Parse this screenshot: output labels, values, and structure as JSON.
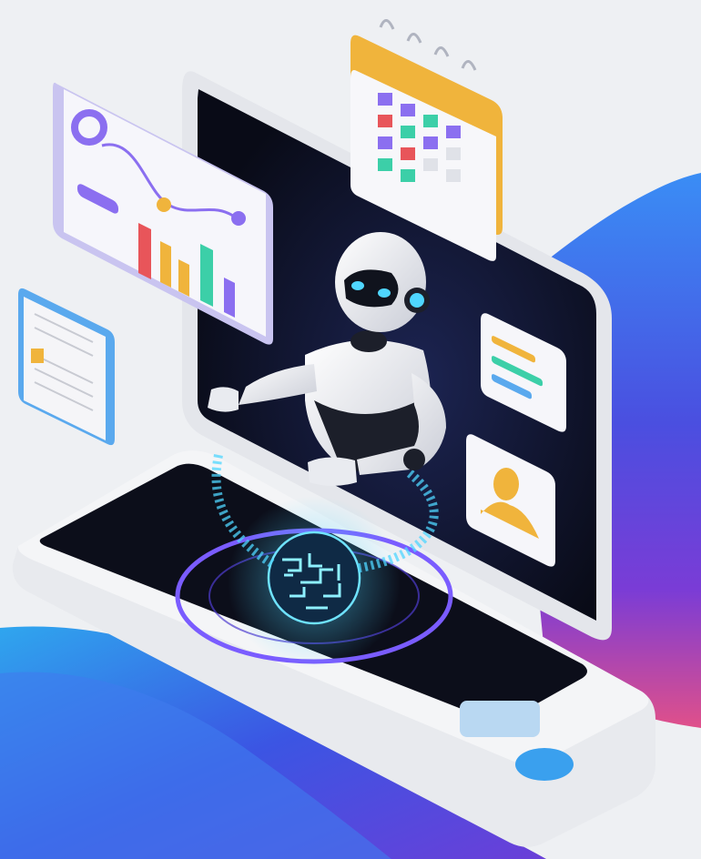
{
  "illustration": {
    "subject": "isometric-ai-robot-workspace",
    "colors": {
      "background": "#eef0f3",
      "wave_blue": "#2f6df0",
      "wave_purple": "#6a3fd8",
      "wave_pink": "#e0508a",
      "screen_dark": "#0d0f1c",
      "frame_light": "#f2f3f6",
      "glow_cyan": "#4fd6ff",
      "ring_violet": "#7a5cff",
      "calendar_binding": "#f0b43c"
    },
    "elements": [
      "monitor-frame",
      "tablet-device",
      "robot",
      "holographic-brain",
      "analytics-chart-card",
      "calendar-card",
      "document-card",
      "text-lines-card",
      "user-profile-card",
      "home-button"
    ]
  }
}
